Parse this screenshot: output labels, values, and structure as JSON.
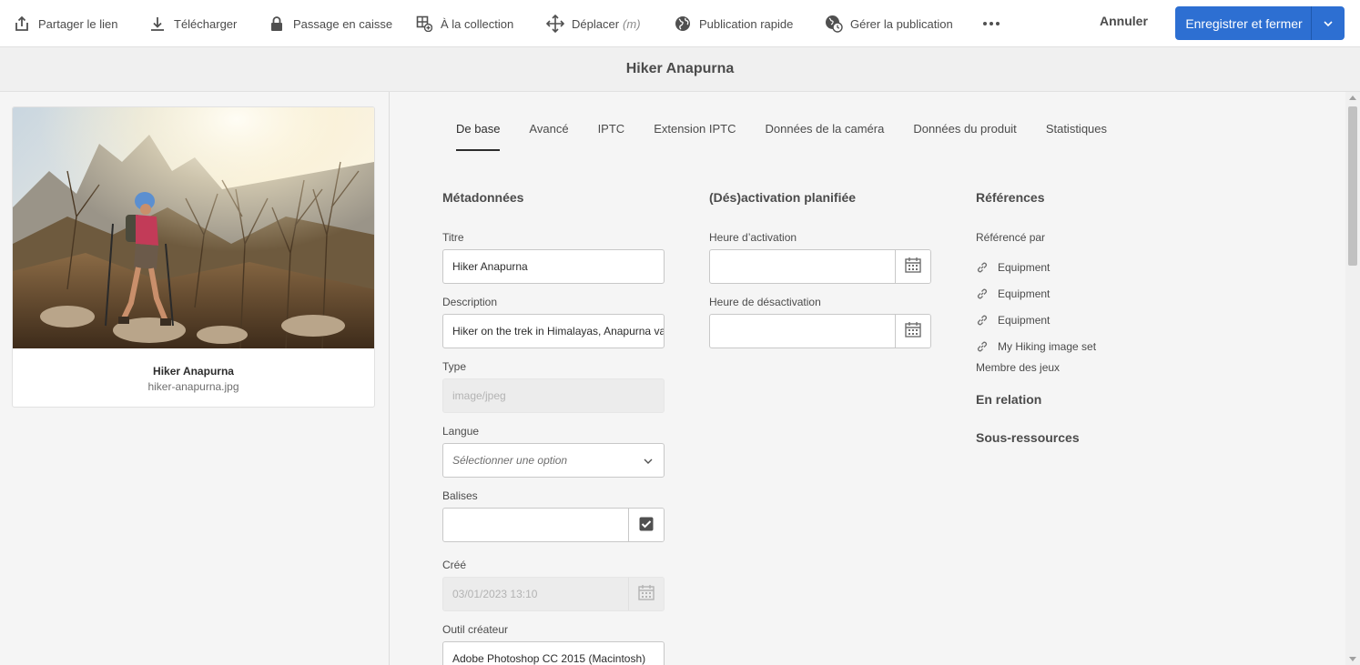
{
  "toolbar": {
    "share_link": "Partager le lien",
    "download": "Télécharger",
    "checkout": "Passage en caisse",
    "to_collection": "À la collection",
    "move": "Déplacer",
    "move_shortcut": "(m)",
    "quick_publish": "Publication rapide",
    "manage_publication": "Gérer la publication",
    "cancel": "Annuler",
    "save_close": "Enregistrer et fermer"
  },
  "page": {
    "title": "Hiker Anapurna"
  },
  "asset": {
    "title": "Hiker Anapurna",
    "filename": "hiker-anapurna.jpg"
  },
  "tabs": [
    {
      "label": "De base",
      "active": true
    },
    {
      "label": "Avancé"
    },
    {
      "label": "IPTC"
    },
    {
      "label": "Extension IPTC"
    },
    {
      "label": "Données de la caméra"
    },
    {
      "label": "Données du produit"
    },
    {
      "label": "Statistiques"
    }
  ],
  "metadata": {
    "section_title": "Métadonnées",
    "title_label": "Titre",
    "title_value": "Hiker Anapurna",
    "description_label": "Description",
    "description_value": "Hiker on the trek in Himalayas, Anapurna valley",
    "type_label": "Type",
    "type_value": "image/jpeg",
    "language_label": "Langue",
    "language_placeholder": "Sélectionner une option",
    "tags_label": "Balises",
    "tags_value": "",
    "created_label": "Créé",
    "created_value": "03/01/2023 13:10",
    "creator_tool_label": "Outil créateur",
    "creator_tool_value": "Adobe Photoshop CC 2015 (Macintosh)"
  },
  "schedule": {
    "section_title": "(Dés)activation planifiée",
    "on_time_label": "Heure d’activation",
    "on_time_value": "",
    "off_time_label": "Heure de désactivation",
    "off_time_value": ""
  },
  "references": {
    "section_title": "Références",
    "referenced_by_label": "Référencé par",
    "items": [
      "Equipment",
      "Equipment",
      "Equipment",
      "My Hiking image set"
    ],
    "sets_member_label": "Membre des jeux",
    "related_label": "En relation",
    "subassets_label": "Sous-ressources"
  },
  "colors": {
    "primary": "#2d6fd2",
    "text": "#4b4b4b",
    "background": "#f5f5f5"
  },
  "icons": [
    "share-icon",
    "download-icon",
    "lock-icon",
    "add-to-collection-icon",
    "move-icon",
    "globe-icon",
    "globe-clock-icon",
    "more-icon",
    "chevron-down-icon",
    "calendar-icon",
    "checkbox-icon",
    "link-icon"
  ]
}
